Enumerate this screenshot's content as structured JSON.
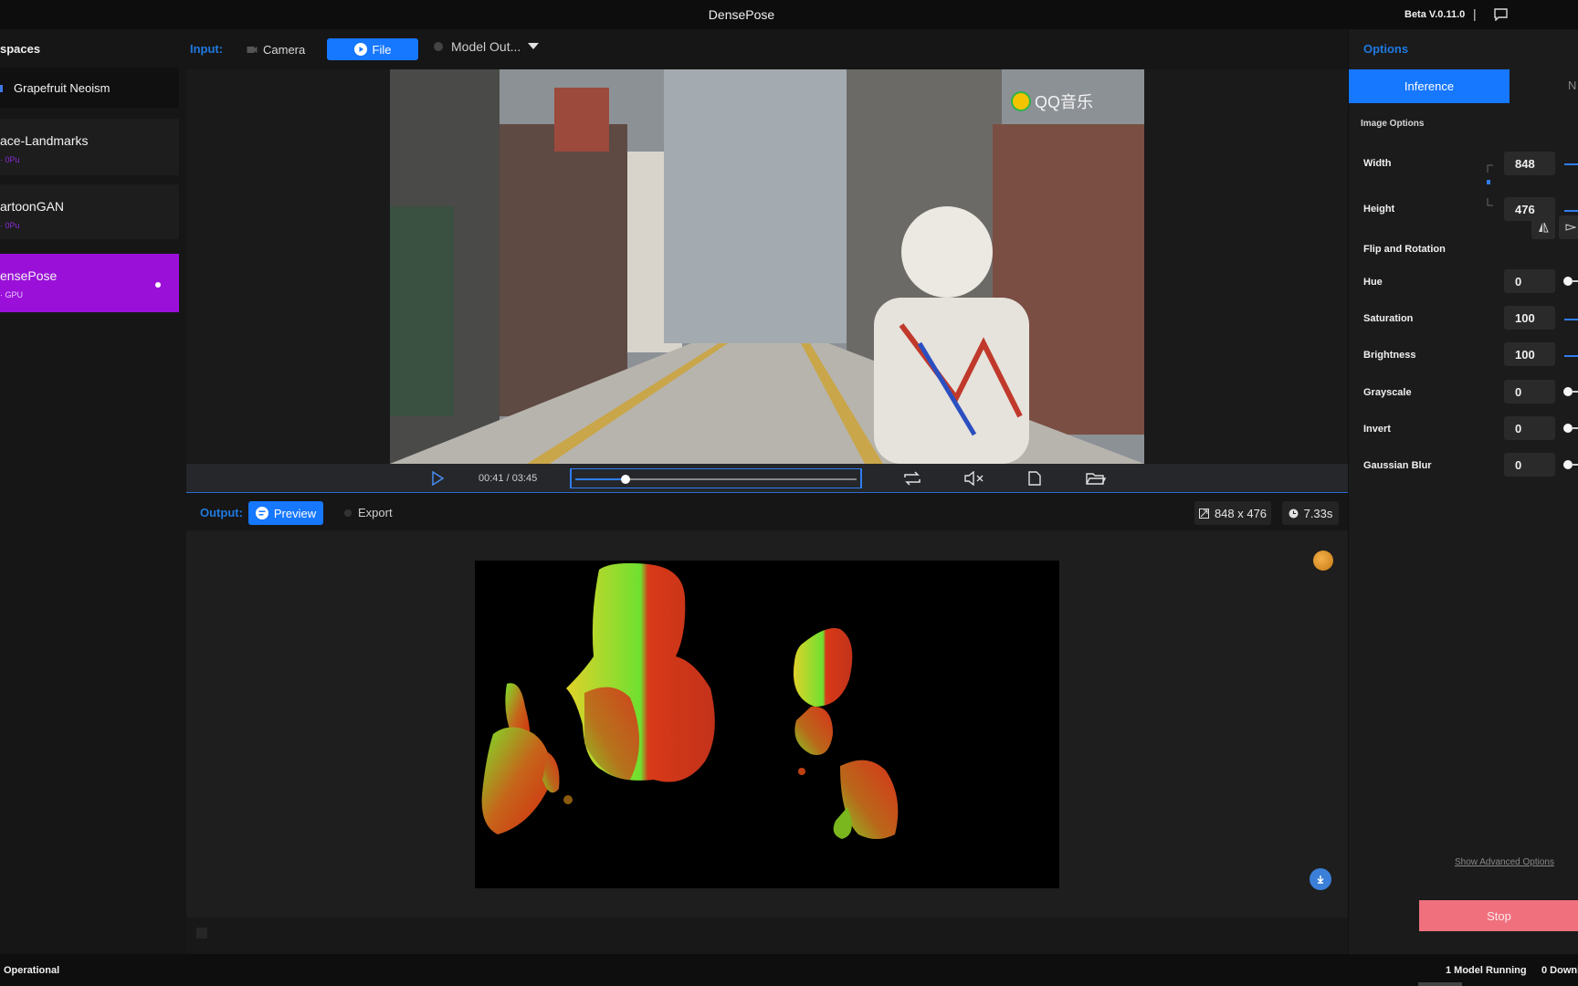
{
  "app": {
    "title": "DensePose",
    "version": "Beta V.0.11.0",
    "separator": "|"
  },
  "sidebar": {
    "title": "spaces",
    "items": [
      {
        "name": "Grapefruit Neoism",
        "sub": ""
      },
      {
        "name": "ace-Landmarks",
        "sub": "· 0Pu"
      },
      {
        "name": "artoonGAN",
        "sub": "· 0Pu"
      },
      {
        "name": "ensePose",
        "sub": "· GPU"
      }
    ]
  },
  "input": {
    "label": "Input:",
    "camera": "Camera",
    "file": "File",
    "model_output": "Model Out..."
  },
  "video": {
    "watermark": "QQ音乐",
    "time": "00:41 / 03:45",
    "progress": 0.18
  },
  "output": {
    "label": "Output:",
    "preview": "Preview",
    "export": "Export",
    "size": "848 x 476",
    "duration": "7.33s"
  },
  "options": {
    "title": "Options",
    "tab_inference": "Inference",
    "tab_other": "N",
    "section": "Image Options",
    "width_label": "Width",
    "width": "848",
    "height_label": "Height",
    "height": "476",
    "flip_label": "Flip and Rotation",
    "hue_label": "Hue",
    "hue": "0",
    "saturation_label": "Saturation",
    "saturation": "100",
    "brightness_label": "Brightness",
    "brightness": "100",
    "grayscale_label": "Grayscale",
    "grayscale": "0",
    "invert_label": "Invert",
    "invert": "0",
    "blur_label": "Gaussian Blur",
    "blur": "0",
    "advanced": "Show Advanced Options",
    "stop": "Stop"
  },
  "status": {
    "left": "Operational",
    "running": "1 Model Running",
    "downloads": "0 Downl"
  },
  "colors": {
    "accent": "#1677ff",
    "active_workspace": "#9b10d9",
    "stop": "#f0707e"
  }
}
